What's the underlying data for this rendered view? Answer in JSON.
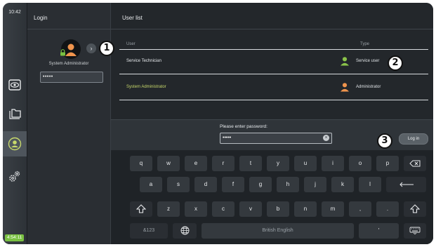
{
  "status": {
    "time": "10:42",
    "battery": "4:54:11"
  },
  "login_panel": {
    "title": "Login",
    "user_name": "System Administrator",
    "password_mask": "•••••"
  },
  "user_list": {
    "title": "User list",
    "col_user": "User",
    "col_type": "Type",
    "rows": [
      {
        "user": "Service Technician",
        "type": "Service user",
        "user_color": "#e6e9ec",
        "icon_color": "#8bc34a"
      },
      {
        "user": "System Administrator",
        "type": "Administrator",
        "user_color": "#c7d86b",
        "icon_color": "#f0944d"
      }
    ]
  },
  "password_prompt": {
    "label": "Please enter password:",
    "value": "•••••",
    "login_button": "Log in"
  },
  "keyboard": {
    "row1": [
      "q",
      "w",
      "e",
      "r",
      "t",
      "y",
      "u",
      "i",
      "o",
      "p"
    ],
    "row2": [
      "a",
      "s",
      "d",
      "f",
      "g",
      "h",
      "j",
      "k",
      "l"
    ],
    "row3": [
      "z",
      "x",
      "c",
      "v",
      "b",
      "n",
      "m",
      ",",
      "."
    ],
    "numbers_key": "&123",
    "space_label": "British English",
    "apostrophe_key": "'"
  },
  "callouts": [
    "1",
    "2",
    "3"
  ],
  "colors": {
    "accent_orange": "#f0944d",
    "accent_green": "#8bc34a",
    "battery": "#7ac142"
  }
}
